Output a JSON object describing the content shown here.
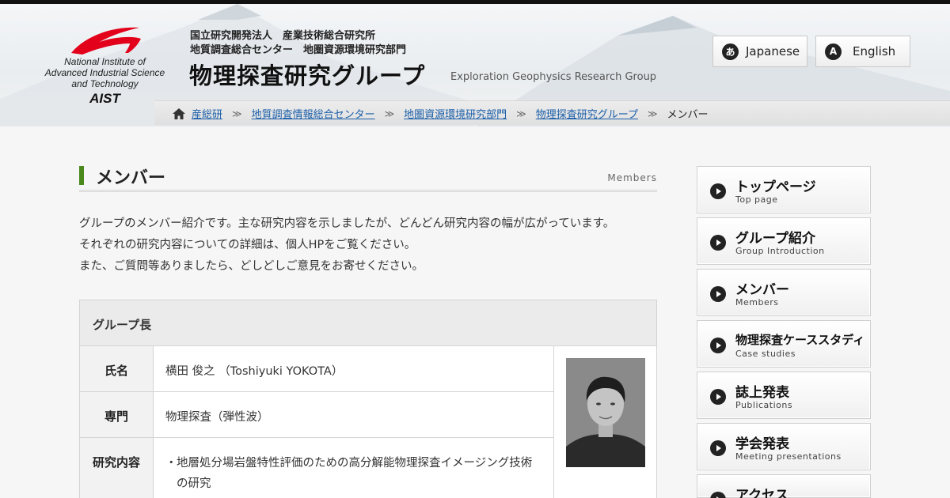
{
  "header": {
    "logo": {
      "line1": "National Institute of",
      "line2": "Advanced Industrial Science",
      "line3": "and Technology",
      "short": "AIST",
      "swoosh_color": "#e3001b"
    },
    "org_line1": "国立研究開発法人　産業技術総合研究所",
    "org_line2": "地質調査総合センター　地圏資源環境研究部門",
    "title": "物理探査研究グループ",
    "subtitle": "Exploration Geophysics Research Group",
    "languages": [
      {
        "badge": "あ",
        "label": "Japanese"
      },
      {
        "badge": "A",
        "label": "English"
      }
    ]
  },
  "breadcrumb": {
    "home_icon": "home-icon",
    "items": [
      "産総研",
      "地質調査情報総合センター",
      "地圏資源環境研究部門",
      "物理探査研究グループ"
    ],
    "separator": "≫",
    "current": "メンバー"
  },
  "main": {
    "title": "メンバー",
    "title_en": "Members",
    "accent_color": "#4a8a1c",
    "intro": [
      "グループのメンバー紹介です。主な研究内容を示しましたが、どんどん研究内容の幅が広がっています。",
      "それぞれの研究内容についての詳細は、個人HPをご覧ください。",
      "また、ご質問等ありましたら、どしどしご意見をお寄せください。"
    ],
    "table": {
      "group_header": "グループ長",
      "rows": [
        {
          "label": "氏名",
          "value": "横田 俊之 （Toshiyuki YOKOTA）"
        },
        {
          "label": "専門",
          "value": "物理探査（弾性波）"
        },
        {
          "label": "研究内容",
          "bullet": "・",
          "items": [
            "地層処分場岩盤特性評価のための高分解能物理探査イメージング技術の研究"
          ]
        }
      ]
    }
  },
  "sidenav": [
    {
      "jp": "トップページ",
      "en": "Top page"
    },
    {
      "jp": "グループ紹介",
      "en": "Group Introduction"
    },
    {
      "jp": "メンバー",
      "en": "Members"
    },
    {
      "jp": "物理探査ケーススタディ",
      "en": "Case studies"
    },
    {
      "jp": "誌上発表",
      "en": "Publications"
    },
    {
      "jp": "学会発表",
      "en": "Meeting presentations"
    },
    {
      "jp": "アクセス",
      "en": ""
    }
  ]
}
